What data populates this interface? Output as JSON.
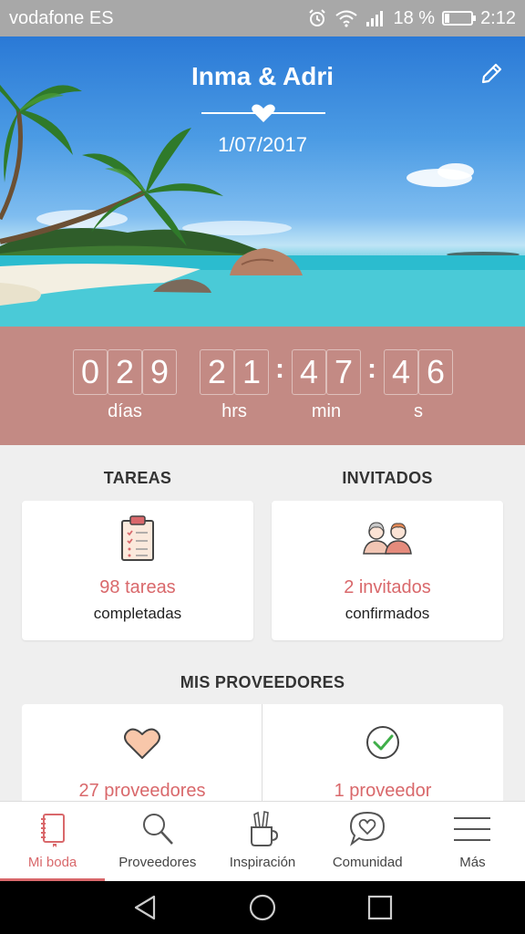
{
  "status_bar": {
    "carrier": "vodafone ES",
    "battery_text": "18 %",
    "battery_level": 0.18,
    "time": "2:12"
  },
  "hero": {
    "couple_name": "Inma & Adri",
    "date": "1/07/2017"
  },
  "countdown": {
    "days_digits": [
      "0",
      "2",
      "9"
    ],
    "hours_digits": [
      "2",
      "1"
    ],
    "minutes_digits": [
      "4",
      "7"
    ],
    "seconds_digits": [
      "4",
      "6"
    ],
    "days_label": "días",
    "hours_label": "hrs",
    "minutes_label": "min",
    "seconds_label": "s",
    "separator": ":"
  },
  "tasks": {
    "title": "TAREAS",
    "count": "98 tareas",
    "sub": "completadas",
    "icon": "clipboard-checklist-icon"
  },
  "guests": {
    "title": "INVITADOS",
    "count": "2 invitados",
    "sub": "confirmados",
    "icon": "couple-guests-icon"
  },
  "providers": {
    "title": "MIS PROVEEDORES",
    "saved_count": "27 proveedores",
    "saved_icon": "heart-icon",
    "hired_count": "1 proveedor",
    "hired_icon": "check-circle-icon"
  },
  "bottom_nav": {
    "items": [
      {
        "label": "Mi boda",
        "icon": "notebook-icon",
        "active": true
      },
      {
        "label": "Proveedores",
        "icon": "search-icon",
        "active": false
      },
      {
        "label": "Inspiración",
        "icon": "pencil-cup-icon",
        "active": false
      },
      {
        "label": "Comunidad",
        "icon": "heart-chat-icon",
        "active": false
      },
      {
        "label": "Más",
        "icon": "menu-icon",
        "active": false
      }
    ]
  },
  "colors": {
    "accent": "#d9686b",
    "countdown_bg": "#c38a84",
    "status_bar_bg": "#a8a8a8"
  }
}
